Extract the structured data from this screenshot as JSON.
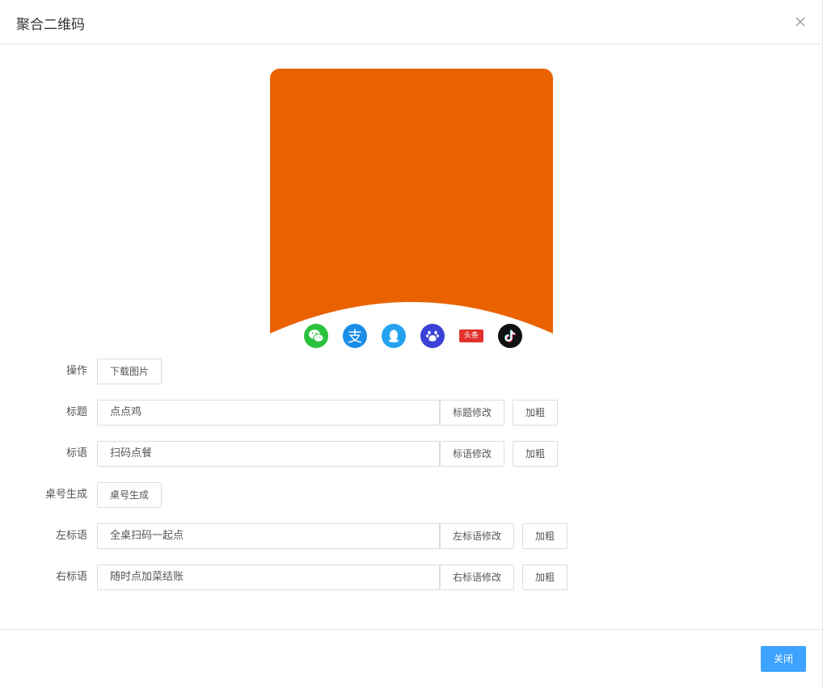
{
  "dialog": {
    "title": "聚合二维码",
    "close_icon": "close-icon"
  },
  "poster": {
    "background_color": "#ea6200",
    "icons": [
      {
        "name": "wechat-icon",
        "color": "#2bc23d"
      },
      {
        "name": "alipay-icon",
        "color": "#1a8de8",
        "glyph": "支"
      },
      {
        "name": "qq-icon",
        "color": "#24a2f0"
      },
      {
        "name": "baidu-icon",
        "color": "#3a41d6"
      },
      {
        "name": "toutiao-icon",
        "color": "#e2322c",
        "glyph": "头条"
      },
      {
        "name": "douyin-icon",
        "color": "#111111"
      }
    ]
  },
  "form": {
    "operation": {
      "label": "操作",
      "download_button": "下载图片"
    },
    "title_row": {
      "label": "标题",
      "value": "点点鸡",
      "modify_button": "标题修改",
      "bold_button": "加粗"
    },
    "slogan_row": {
      "label": "标语",
      "value": "扫码点餐",
      "modify_button": "标语修改",
      "bold_button": "加粗"
    },
    "table_row": {
      "label": "桌号生成",
      "generate_button": "桌号生成"
    },
    "left_slogan_row": {
      "label": "左标语",
      "value": "全桌扫码一起点",
      "modify_button": "左标语修改",
      "bold_button": "加粗"
    },
    "right_slogan_row": {
      "label": "右标语",
      "value": "随时点加菜结账",
      "modify_button": "右标语修改",
      "bold_button": "加粗"
    }
  },
  "footer": {
    "close_button": "关闭",
    "primary_color": "#3ea2ff"
  }
}
